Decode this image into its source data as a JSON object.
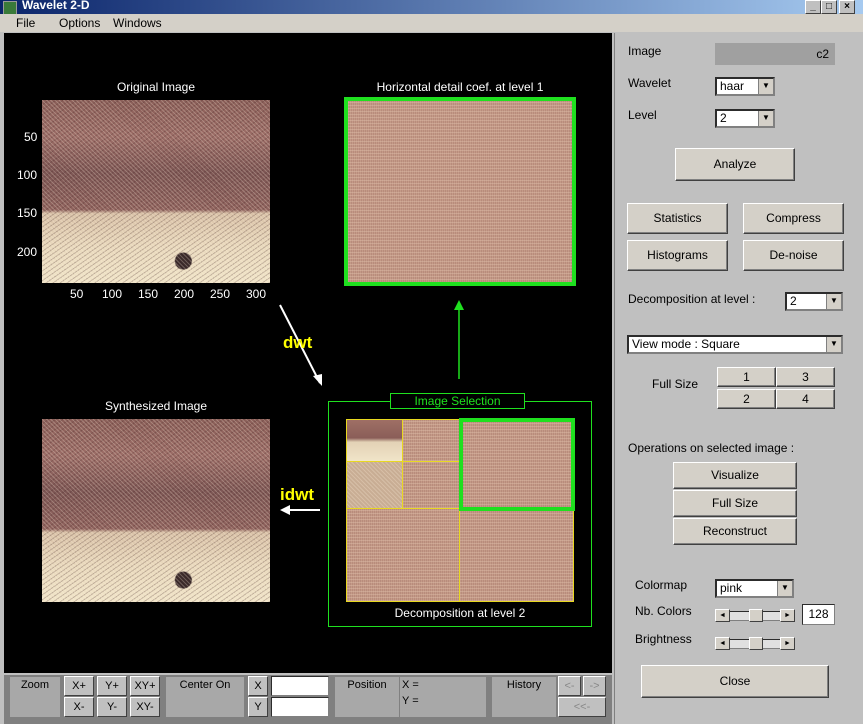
{
  "window": {
    "title": "Wavelet 2-D"
  },
  "menu": {
    "items": [
      "File",
      "Options",
      "Windows"
    ]
  },
  "axes": {
    "original_title": "Original Image",
    "y_ticks": [
      "50",
      "100",
      "150",
      "200"
    ],
    "x_ticks": [
      "50",
      "100",
      "150",
      "200",
      "250",
      "300"
    ],
    "detail_title": "Horizontal detail coef. at level 1",
    "synth_title": "Synthesized Image",
    "selection_title": "Image Selection",
    "decomp_caption": "Decomposition at level 2",
    "dwt_label": "dwt",
    "idwt_label": "idwt"
  },
  "panel": {
    "image_label": "Image",
    "image_value": "c2",
    "wavelet_label": "Wavelet",
    "wavelet_value": "haar",
    "level_label": "Level",
    "level_value": "2",
    "analyze": "Analyze",
    "statistics": "Statistics",
    "compress": "Compress",
    "histograms": "Histograms",
    "denoise": "De-noise",
    "decomp_level_label": "Decomposition at level :",
    "decomp_level_value": "2",
    "view_mode": "View mode : Square",
    "full_size_label": "Full Size",
    "fs1": "1",
    "fs2": "2",
    "fs3": "3",
    "fs4": "4",
    "ops_label": "Operations on selected image :",
    "visualize": "Visualize",
    "full_size": "Full Size",
    "reconstruct": "Reconstruct",
    "colormap_label": "Colormap",
    "colormap_value": "pink",
    "nb_colors_label": "Nb. Colors",
    "nb_colors_value": "128",
    "brightness_label": "Brightness",
    "close": "Close"
  },
  "bottom": {
    "zoom": "Zoom",
    "xp": "X+",
    "yp": "Y+",
    "xyp": "XY+",
    "xm": "X-",
    "ym": "Y-",
    "xym": "XY-",
    "center_on": "Center On",
    "x": "X",
    "y": "Y",
    "position": "Position",
    "x_eq": "X =",
    "y_eq": "Y =",
    "history": "History",
    "h_left": "<-",
    "h_right": "->",
    "h_first": "<<-"
  }
}
